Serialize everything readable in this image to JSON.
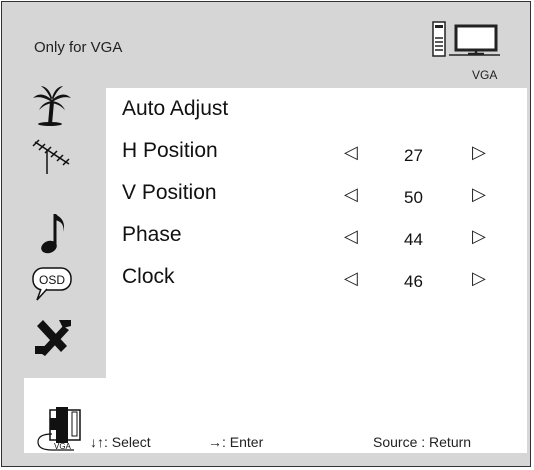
{
  "header": {
    "title": "Only for VGA",
    "input_label": "VGA"
  },
  "sidebar": {
    "items": [
      {
        "icon": "palm-tree-icon"
      },
      {
        "icon": "antenna-icon"
      },
      {
        "icon": "music-note-icon"
      },
      {
        "icon": "osd-icon",
        "label": "OSD"
      },
      {
        "icon": "tools-icon"
      }
    ]
  },
  "menu": {
    "auto_adjust": "Auto Adjust",
    "items": [
      {
        "label": "H Position",
        "value": "27"
      },
      {
        "label": "V Position",
        "value": "50"
      },
      {
        "label": "Phase",
        "value": "44"
      },
      {
        "label": "Clock",
        "value": "46"
      }
    ],
    "arrow_left": "◁",
    "arrow_right": "▷"
  },
  "footer": {
    "source_label": "VGA",
    "select_hint": "↓↑: Select",
    "enter_hint": "→: Enter",
    "return_hint": "Source : Return"
  },
  "colors": {
    "background": "#d6d6d6",
    "panel": "#ffffff",
    "border": "#333333"
  }
}
